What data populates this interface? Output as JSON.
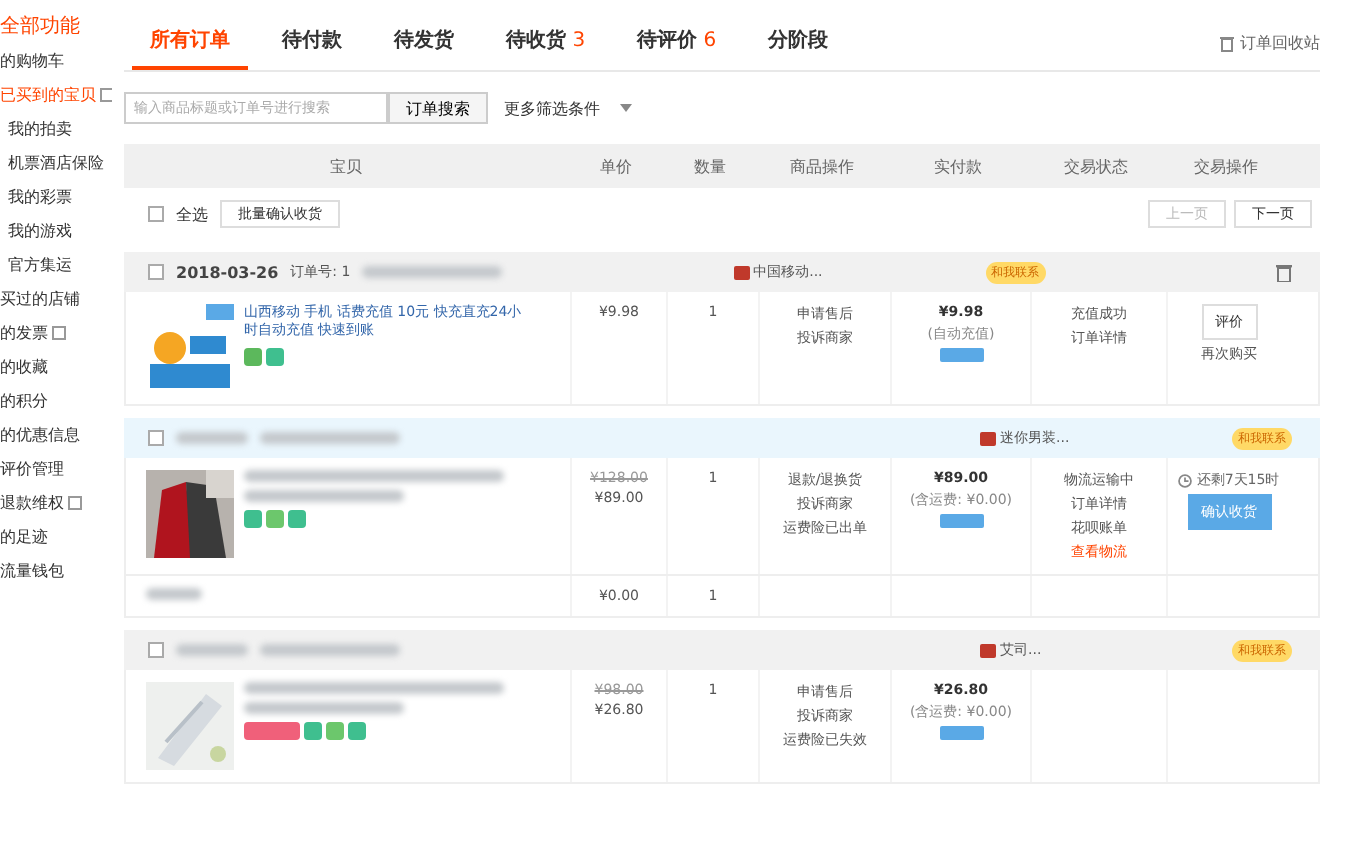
{
  "sidebar": {
    "items": [
      {
        "label": "全部功能",
        "kind": "heading",
        "expandable": false
      },
      {
        "label": "的购物车",
        "kind": "link",
        "expandable": false
      },
      {
        "label": "已买到的宝贝",
        "kind": "heading",
        "expandable": true
      },
      {
        "label": "我的拍卖",
        "kind": "sub",
        "expandable": false
      },
      {
        "label": "机票酒店保险",
        "kind": "sub",
        "expandable": false
      },
      {
        "label": "我的彩票",
        "kind": "sub",
        "expandable": false
      },
      {
        "label": "我的游戏",
        "kind": "sub",
        "expandable": false
      },
      {
        "label": "官方集运",
        "kind": "sub",
        "expandable": false
      },
      {
        "label": "买过的店铺",
        "kind": "link",
        "expandable": false
      },
      {
        "label": "的发票",
        "kind": "link",
        "expandable": true
      },
      {
        "label": "的收藏",
        "kind": "link",
        "expandable": false
      },
      {
        "label": "的积分",
        "kind": "link",
        "expandable": false
      },
      {
        "label": "的优惠信息",
        "kind": "link",
        "expandable": false
      },
      {
        "label": "评价管理",
        "kind": "link",
        "expandable": false
      },
      {
        "label": "退款维权",
        "kind": "link",
        "expandable": true
      },
      {
        "label": "的足迹",
        "kind": "link",
        "expandable": false
      },
      {
        "label": "流量钱包",
        "kind": "link",
        "expandable": false
      }
    ]
  },
  "tabs": [
    {
      "label": "所有订单",
      "selected": true
    },
    {
      "label": "待付款",
      "selected": false
    },
    {
      "label": "待发货",
      "selected": false
    },
    {
      "label": "待收货",
      "count": "3",
      "selected": false
    },
    {
      "label": "待评价",
      "count": "6",
      "selected": false
    },
    {
      "label": "分阶段",
      "selected": false
    }
  ],
  "recycle_bin": "订单回收站",
  "search": {
    "placeholder": "输入商品标题或订单号进行搜索",
    "button": "订单搜索",
    "more_filters": "更多筛选条件"
  },
  "table": {
    "columns": [
      "宝贝",
      "单价",
      "数量",
      "商品操作",
      "实付款",
      "交易状态",
      "交易操作"
    ]
  },
  "bulk": {
    "select_all": "全选",
    "select_all_checked": false,
    "confirm_button": "批量确认收货",
    "prev": "上一页",
    "prev_disabled": true,
    "next": "下一页",
    "next_disabled": false
  },
  "orders": [
    {
      "highlighted": false,
      "checked": false,
      "date": "2018-03-26",
      "order_no": "订单号: 1",
      "shop": "中国移动...",
      "contact": "和我联系",
      "trash": true,
      "items": [
        {
          "kind": "product",
          "title": "山西移动 手机 话费充值 10元 快充直充24小时自动充值 快速到账",
          "tags": [
            {
              "color": "#5cb85c"
            },
            {
              "color": "#3fbf8f"
            }
          ],
          "price": "¥9.98",
          "qty": "1",
          "actions": [
            "申请售后",
            "投诉商家"
          ],
          "paid": "¥9.98",
          "paid_note": "(自动充值)",
          "status": [
            {
              "text": "充值成功",
              "kind": "plain"
            },
            {
              "text": "订单详情",
              "kind": "plain"
            }
          ],
          "op_button": {
            "text": "评价",
            "kind": "outline"
          },
          "op_links": [
            "再次购买"
          ]
        }
      ]
    },
    {
      "highlighted": true,
      "checked": false,
      "shop": "迷你男装...",
      "contact": "和我联系",
      "trash": false,
      "items": [
        {
          "kind": "product",
          "tags": [
            {
              "color": "#3fbf8f"
            },
            {
              "color": "#6cc76c"
            },
            {
              "color": "#3fbf8f"
            }
          ],
          "old_price": "¥128.00",
          "price": "¥89.00",
          "qty": "1",
          "actions": [
            "退款/退换货",
            "投诉商家",
            "运费险已出单"
          ],
          "paid": "¥89.00",
          "paid_note": "(含运费: ¥0.00)",
          "status": [
            {
              "text": "物流运输中",
              "kind": "plain"
            },
            {
              "text": "订单详情",
              "kind": "plain"
            },
            {
              "text": "花呗账单",
              "kind": "plain"
            },
            {
              "text": "查看物流",
              "kind": "link"
            }
          ],
          "deadline": "还剩7天15时",
          "op_button": {
            "text": "确认收货",
            "kind": "primary"
          }
        },
        {
          "kind": "extra",
          "price": "¥0.00",
          "qty": "1"
        }
      ]
    },
    {
      "highlighted": false,
      "checked": false,
      "shop": "艾司...",
      "contact": "和我联系",
      "trash": false,
      "items": [
        {
          "kind": "product",
          "tags": [
            {
              "color": "#f0607a"
            },
            {
              "color": "#3fbf8f"
            },
            {
              "color": "#6cc76c"
            },
            {
              "color": "#3fbf8f"
            }
          ],
          "old_price": "¥98.00",
          "price": "¥26.80",
          "qty": "1",
          "actions": [
            "申请售后",
            "投诉商家",
            "运费险已失效"
          ],
          "paid": "¥26.80",
          "paid_note": "(含运费: ¥0.00)"
        }
      ]
    }
  ]
}
